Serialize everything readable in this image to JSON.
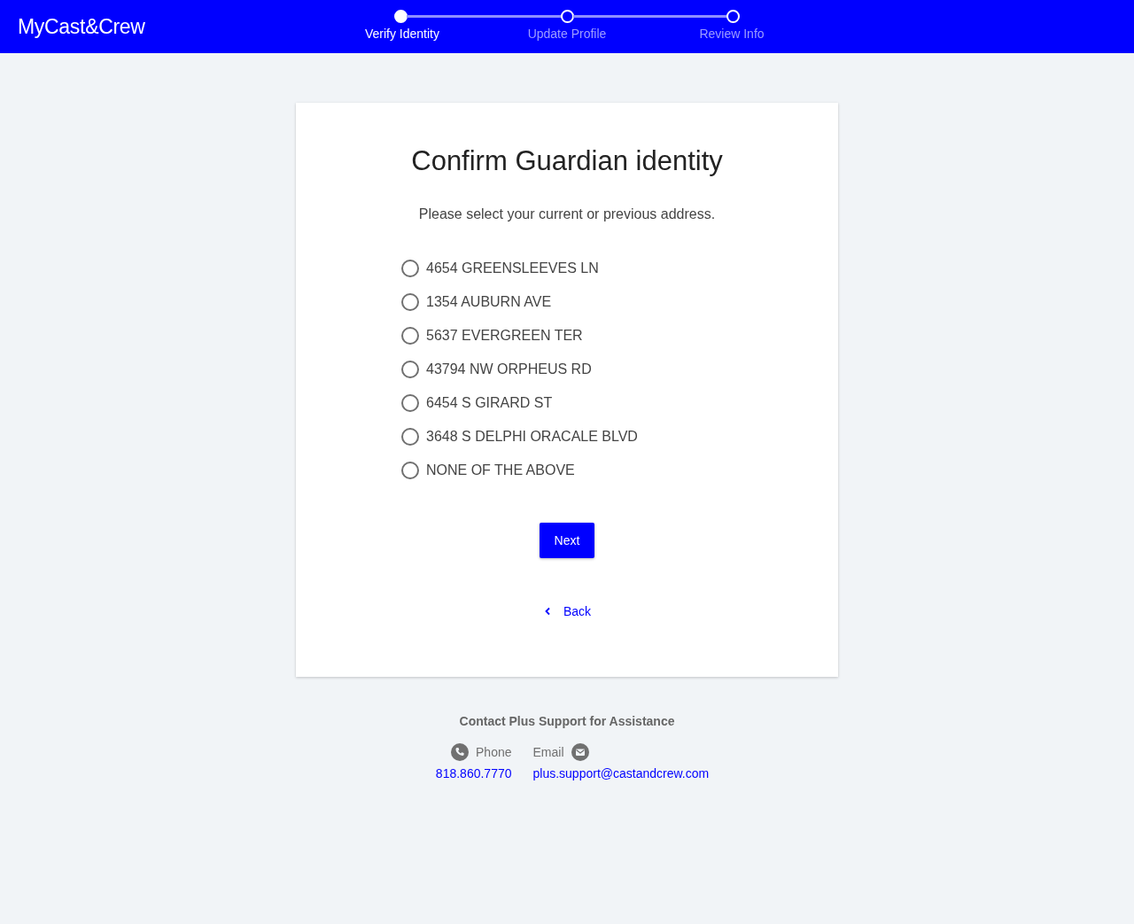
{
  "brand": "MyCast&Crew",
  "steps": [
    {
      "label": "Verify Identity",
      "selected": true
    },
    {
      "label": "Update Profile",
      "selected": false
    },
    {
      "label": "Review Info",
      "selected": false
    }
  ],
  "card": {
    "title": "Confirm Guardian identity",
    "instruction": "Please select your current or previous address.",
    "options": [
      {
        "label": "4654 GREENSLEEVES LN",
        "selected": false
      },
      {
        "label": "1354 AUBURN AVE",
        "selected": false
      },
      {
        "label": "5637 EVERGREEN TER",
        "selected": false
      },
      {
        "label": "43794 NW ORPHEUS RD",
        "selected": false
      },
      {
        "label": "6454 S GIRARD ST",
        "selected": false
      },
      {
        "label": "3648 S DELPHI ORACALE BLVD",
        "selected": false
      },
      {
        "label": "NONE OF THE ABOVE",
        "selected": false
      }
    ],
    "next_button": "Next",
    "back_link": "Back"
  },
  "support": {
    "heading": "Contact Plus Support for Assistance",
    "phone_label": "Phone",
    "email_label": "Email",
    "phone": "818.860.7770",
    "email": "plus.support@castandcrew.com"
  }
}
